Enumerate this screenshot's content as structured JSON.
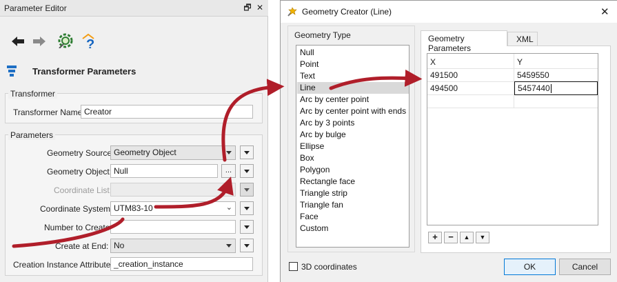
{
  "parameter_editor": {
    "window_title": "Parameter Editor",
    "pin_glyph": "🗗",
    "close_glyph": "✕",
    "section_heading": "Transformer Parameters",
    "transformer_group": {
      "title": "Transformer",
      "name_label": "Transformer Name:",
      "name_value": "Creator"
    },
    "parameters_group": {
      "title": "Parameters",
      "geometry_source_label": "Geometry Source:",
      "geometry_source_value": "Geometry Object",
      "geometry_object_label": "Geometry Object:",
      "geometry_object_value": "Null",
      "ellipsis": "...",
      "coordinate_list_label": "Coordinate List:",
      "coordinate_system_label": "Coordinate System:",
      "coordinate_system_value": "UTM83-10",
      "number_to_create_label": "Number to Create:",
      "create_at_end_label": "Create at End:",
      "create_at_end_value": "No",
      "creation_instance_label": "Creation Instance Attribute:",
      "creation_instance_value": "_creation_instance"
    }
  },
  "geometry_creator": {
    "window_title": "Geometry Creator (Line)",
    "close_glyph": "✕",
    "geometry_type_title": "Geometry Type",
    "geometry_types": [
      "Null",
      "Point",
      "Text",
      "Line",
      "Arc by center point",
      "Arc by center point with ends",
      "Arc by 3 points",
      "Arc by bulge",
      "Ellipse",
      "Box",
      "Polygon",
      "Rectangle face",
      "Triangle strip",
      "Triangle fan",
      "Face",
      "Custom"
    ],
    "selected_type": "Line",
    "tabs": [
      "Geometry Parameters",
      "XML"
    ],
    "table": {
      "columns": [
        "X",
        "Y"
      ],
      "rows": [
        [
          "491500",
          "5459550"
        ],
        [
          "494500",
          "5457440"
        ]
      ]
    },
    "row_buttons": [
      "+",
      "−",
      "▲",
      "▼"
    ],
    "coordinates_3d_label": "3D coordinates",
    "coordinates_3d_checked": false,
    "ok_label": "OK",
    "cancel_label": "Cancel"
  },
  "colors": {
    "annotation_arrow": "#b01e2a",
    "selection_bg": "#d9d9d9",
    "ok_border": "#0078d7"
  },
  "icons": [
    "back-arrow-icon",
    "forward-arrow-icon",
    "settings-gear-icon",
    "help-icon",
    "transformer-parameters-icon",
    "geometry-creator-icon"
  ]
}
